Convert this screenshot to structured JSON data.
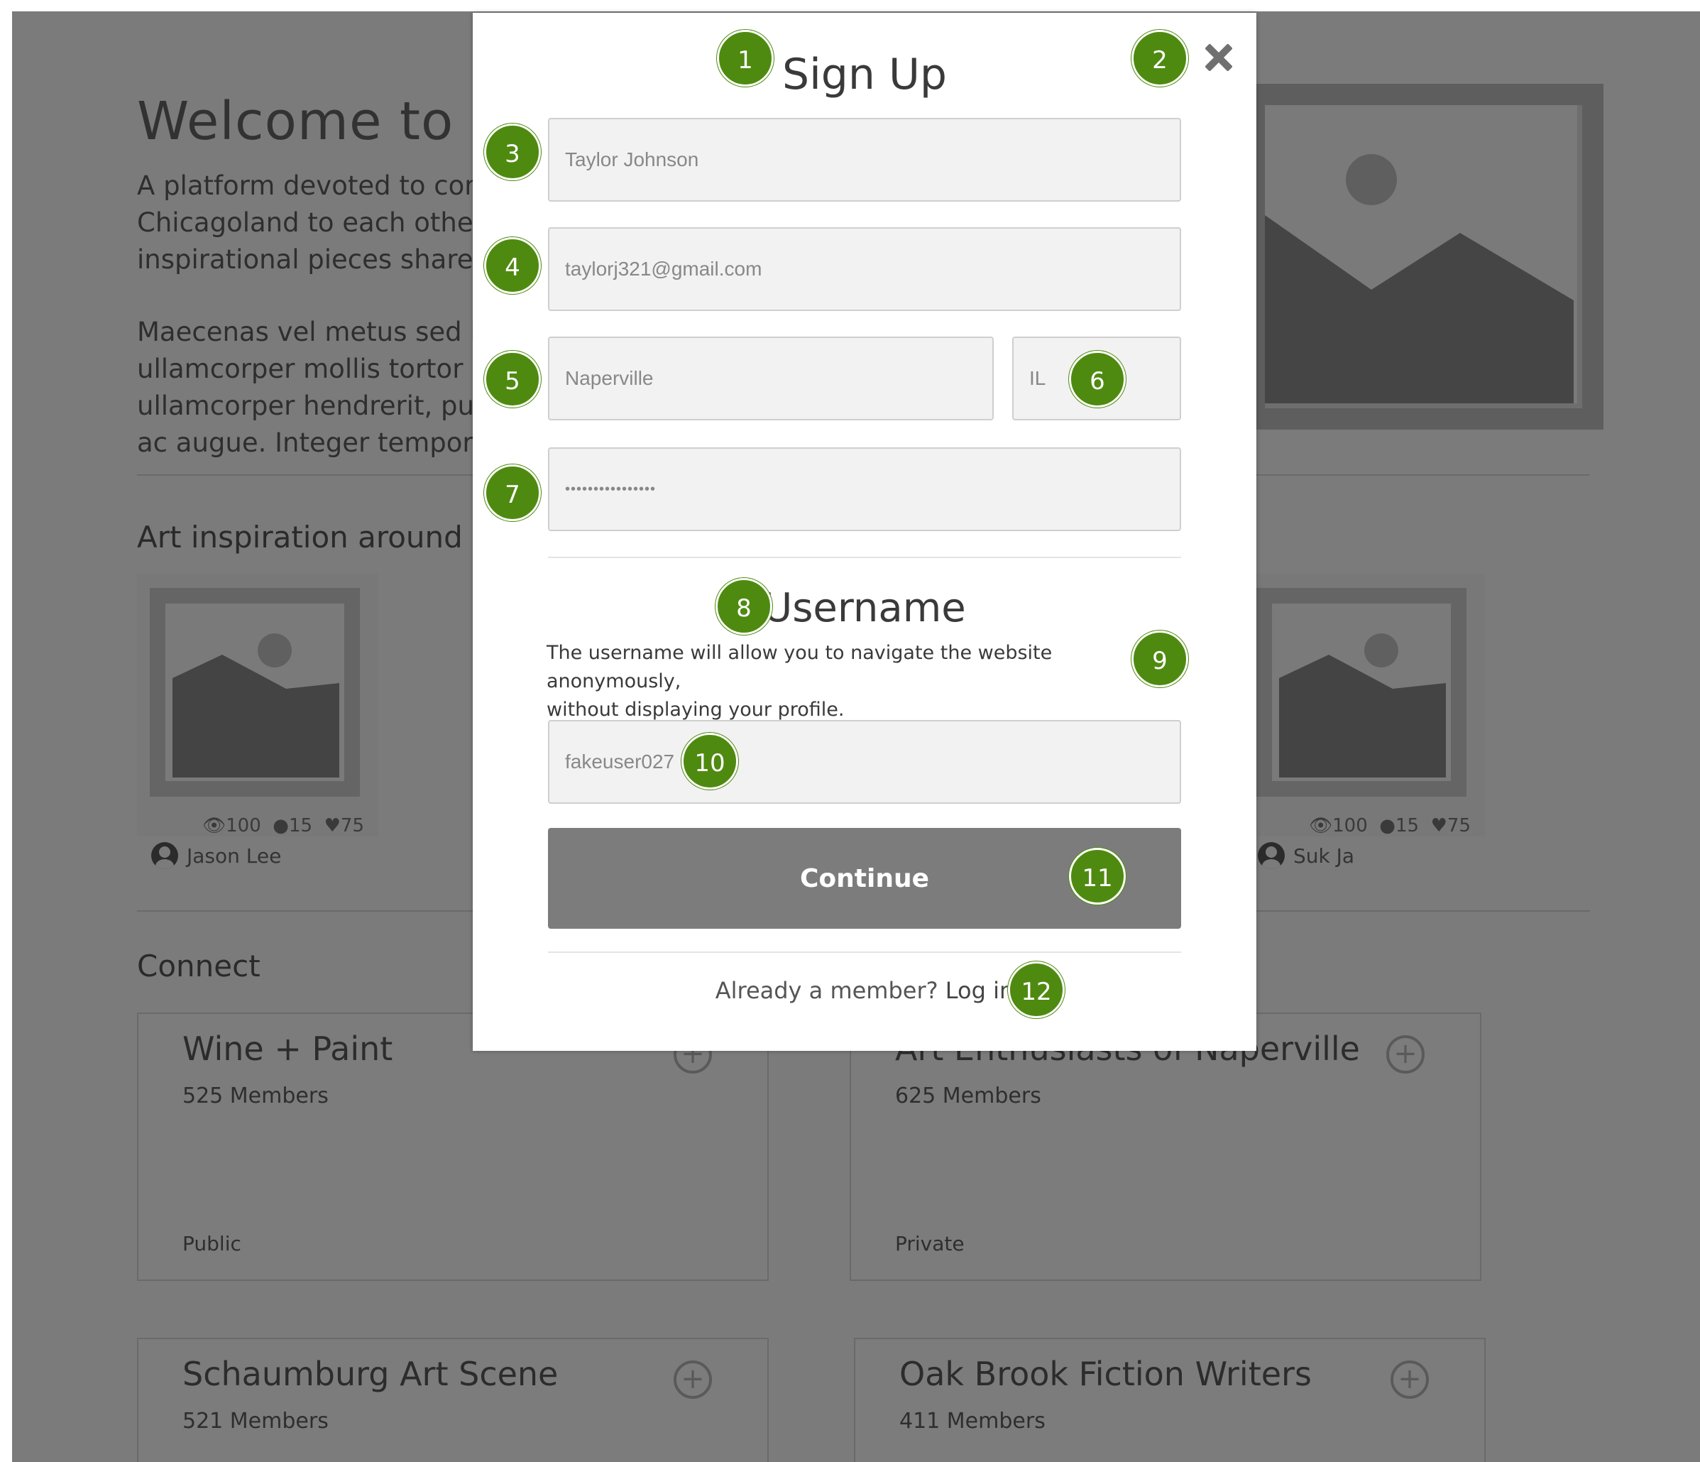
{
  "background": {
    "welcome_title": "Welcome to IN",
    "intro_lines": [
      "A platform devoted to con",
      "Chicagoland to each other",
      "inspirational pieces shared"
    ],
    "body_lines": [
      "Maecenas vel metus sed lib",
      "ullamcorper mollis tortor la",
      "ullamcorper hendrerit, pur",
      "ac augue. Integer tempor v"
    ],
    "art_section_title": "Art inspiration around C",
    "art_cards": [
      {
        "views": "100",
        "comments": "15",
        "likes": "75",
        "author": "Jason Lee"
      },
      {
        "views": "100",
        "comments": "15",
        "likes": "75",
        "author": "Suk Ja"
      }
    ],
    "connect_title": "Connect",
    "groups": [
      {
        "name": "Wine + Paint",
        "members": "525 Members",
        "type": "Public"
      },
      {
        "name": "Art Enthusiasts of Naperville",
        "members": "625 Members",
        "type": "Private"
      },
      {
        "name": "Schaumburg Art Scene",
        "members": "521 Members",
        "type": ""
      },
      {
        "name": "Oak Brook Fiction Writers",
        "members": "411 Members",
        "type": ""
      }
    ]
  },
  "modal": {
    "title": "Sign Up",
    "fields": {
      "name": "Taylor Johnson",
      "email": "taylorj321@gmail.com",
      "city": "Naperville",
      "state": "IL",
      "password": "••••••••••••••••",
      "username": "fakeuser027"
    },
    "username_heading": "Username",
    "username_description_1": "The username will allow you to navigate the website anonymously,",
    "username_description_2": "without displaying your profile.",
    "continue_label": "Continue",
    "login_prompt": "Already a member?",
    "login_link": "Log in"
  },
  "badges": [
    "1",
    "2",
    "3",
    "4",
    "5",
    "6",
    "7",
    "8",
    "9",
    "10",
    "11",
    "12"
  ],
  "colors": {
    "badge": "#4f8a10",
    "overlay": "#7b7b7b",
    "button": "#7c7c7c"
  }
}
